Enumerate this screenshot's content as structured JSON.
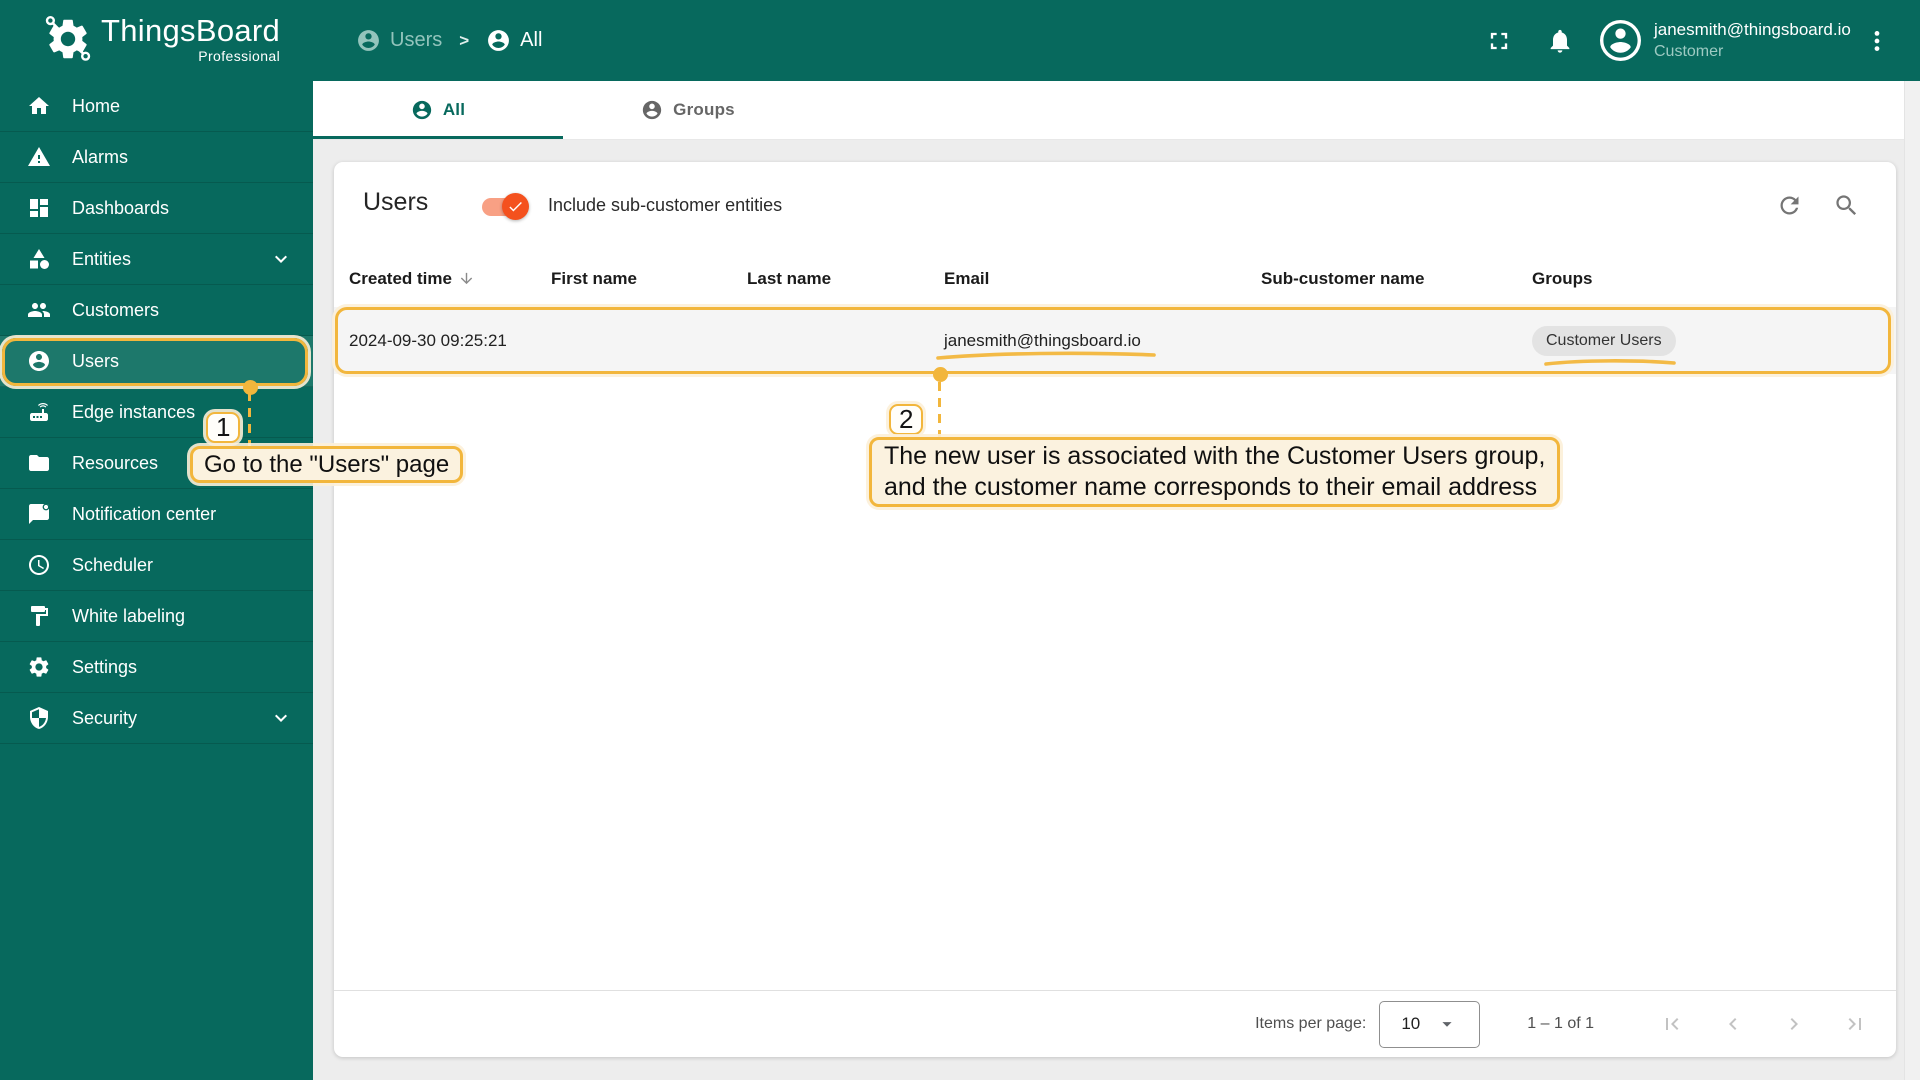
{
  "brand": {
    "name": "ThingsBoard",
    "tagline": "Professional"
  },
  "header": {
    "breadcrumb": [
      {
        "label": "Users"
      },
      {
        "label": "All"
      }
    ],
    "breadcrumb_separator": ">",
    "user": {
      "email": "janesmith@thingsboard.io",
      "role": "Customer"
    }
  },
  "sidebar": {
    "items": [
      {
        "label": "Home"
      },
      {
        "label": "Alarms"
      },
      {
        "label": "Dashboards"
      },
      {
        "label": "Entities"
      },
      {
        "label": "Customers"
      },
      {
        "label": "Users"
      },
      {
        "label": "Edge instances"
      },
      {
        "label": "Resources"
      },
      {
        "label": "Notification center"
      },
      {
        "label": "Scheduler"
      },
      {
        "label": "White labeling"
      },
      {
        "label": "Settings"
      },
      {
        "label": "Security"
      }
    ],
    "selected": "Users"
  },
  "tabs": [
    {
      "label": "All",
      "active": true
    },
    {
      "label": "Groups",
      "active": false
    }
  ],
  "panel": {
    "title": "Users",
    "toggle_label": "Include sub-customer entities",
    "toggle_on": true
  },
  "table": {
    "columns": [
      "Created time",
      "First name",
      "Last name",
      "Email",
      "Sub-customer name",
      "Groups"
    ],
    "sorted_by": "Created time",
    "sort_direction": "desc",
    "rows": [
      {
        "created_time": "2024-09-30 09:25:21",
        "first_name": "",
        "last_name": "",
        "email": "janesmith@thingsboard.io",
        "sub_customer_name": "",
        "groups": [
          "Customer Users"
        ]
      }
    ]
  },
  "pagination": {
    "items_per_page_label": "Items per page:",
    "page_size": "10",
    "range": "1 – 1 of 1"
  },
  "annotations": {
    "step1": {
      "number": "1",
      "text": "Go to the \"Users\" page"
    },
    "step2": {
      "number": "2",
      "line1": "The new user is associated with the Customer Users group,",
      "line2": "and the customer name corresponds to their email address"
    }
  },
  "colors": {
    "primary_teal": "#07695D",
    "selected_item_teal": "#1D786B",
    "accent_orange": "#F4511E",
    "annotation_yellow": "#F2B63C",
    "callout_bg": "#FBF2DF",
    "row_bg": "#F5F5F5"
  },
  "icons": [
    "logo-gear",
    "account-circle",
    "fullscreen",
    "bell",
    "more-vert",
    "home",
    "warning",
    "dashboard",
    "category",
    "people",
    "router",
    "folder",
    "chat",
    "clock",
    "paint-roller",
    "gear",
    "shield",
    "chevron-down",
    "refresh",
    "search",
    "sort-desc",
    "first-page",
    "prev-page",
    "next-page",
    "last-page",
    "dropdown-arrow",
    "check"
  ]
}
